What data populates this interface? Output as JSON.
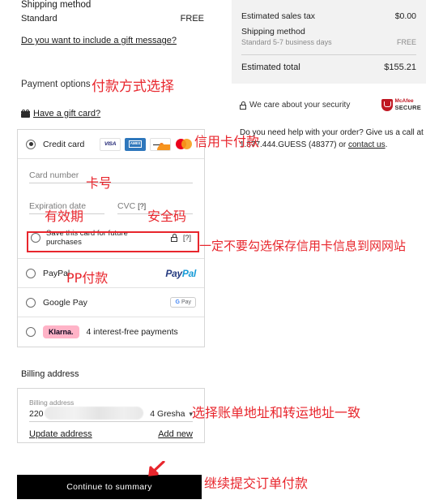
{
  "left": {
    "shipping_method_title": "Shipping method",
    "shipping_option": "Standard",
    "shipping_price": "FREE",
    "gift_message_link": "Do you want to include a gift message?",
    "payment_options_title": "Payment options",
    "gift_card_link": "Have a gift card?",
    "payment_methods": [
      {
        "id": "credit-card",
        "label": "Credit card",
        "selected": true
      },
      {
        "id": "paypal",
        "label": "PayPal",
        "selected": false
      },
      {
        "id": "google-pay",
        "label": "Google Pay",
        "selected": false
      },
      {
        "id": "klarna",
        "label": "4 interest-free payments",
        "brand": "Klarna.",
        "selected": false
      }
    ],
    "credit_card_form": {
      "card_number_label": "Card number",
      "expiration_label": "Expiration date",
      "cvc_label": "CVC",
      "cvc_help": "[?]",
      "save_card_label": "Save this card for future purchases",
      "save_card_help": "[?]",
      "save_card_checked": false
    },
    "billing": {
      "section_title": "Billing address",
      "field_label": "Billing address",
      "value_start": "220",
      "value_end": "4 Gresha",
      "update_link": "Update address",
      "add_new_link": "Add new"
    },
    "continue_button": "Continue to summary"
  },
  "right": {
    "summary": {
      "tax_label": "Estimated sales tax",
      "tax_value": "$0.00",
      "shipping_label": "Shipping method",
      "shipping_sub_label": "Standard 5-7 business days",
      "shipping_sub_value": "FREE",
      "total_label": "Estimated total",
      "total_value": "$155.21"
    },
    "security_text": "We care about your security",
    "mcafee_line1": "McAfee",
    "mcafee_line2": "SECURE",
    "help_text_before": "Do you need help with your order? Give us a call at ",
    "help_phone": "1.877.444.GUESS (48377)",
    "help_text_mid": " or ",
    "help_contact_link": "contact us",
    "help_text_after": "."
  },
  "annotations": {
    "payment_options": "付款方式选择",
    "credit_card": "信用卡付款",
    "card_number": "卡号",
    "expiration": "有效期",
    "cvc": "安全码",
    "save_card": "一定不要勾选保存信用卡信息到网网站",
    "paypal": "PP付款",
    "billing_address": "选择账单地址和转运地址一致",
    "continue": "继续提交订单付款"
  },
  "colors": {
    "annotation_red": "#e8262d",
    "button_black": "#000000",
    "summary_bg": "#f2f2f2",
    "klarna_pink": "#ffb3c7",
    "mcafee_red": "#c01722"
  }
}
